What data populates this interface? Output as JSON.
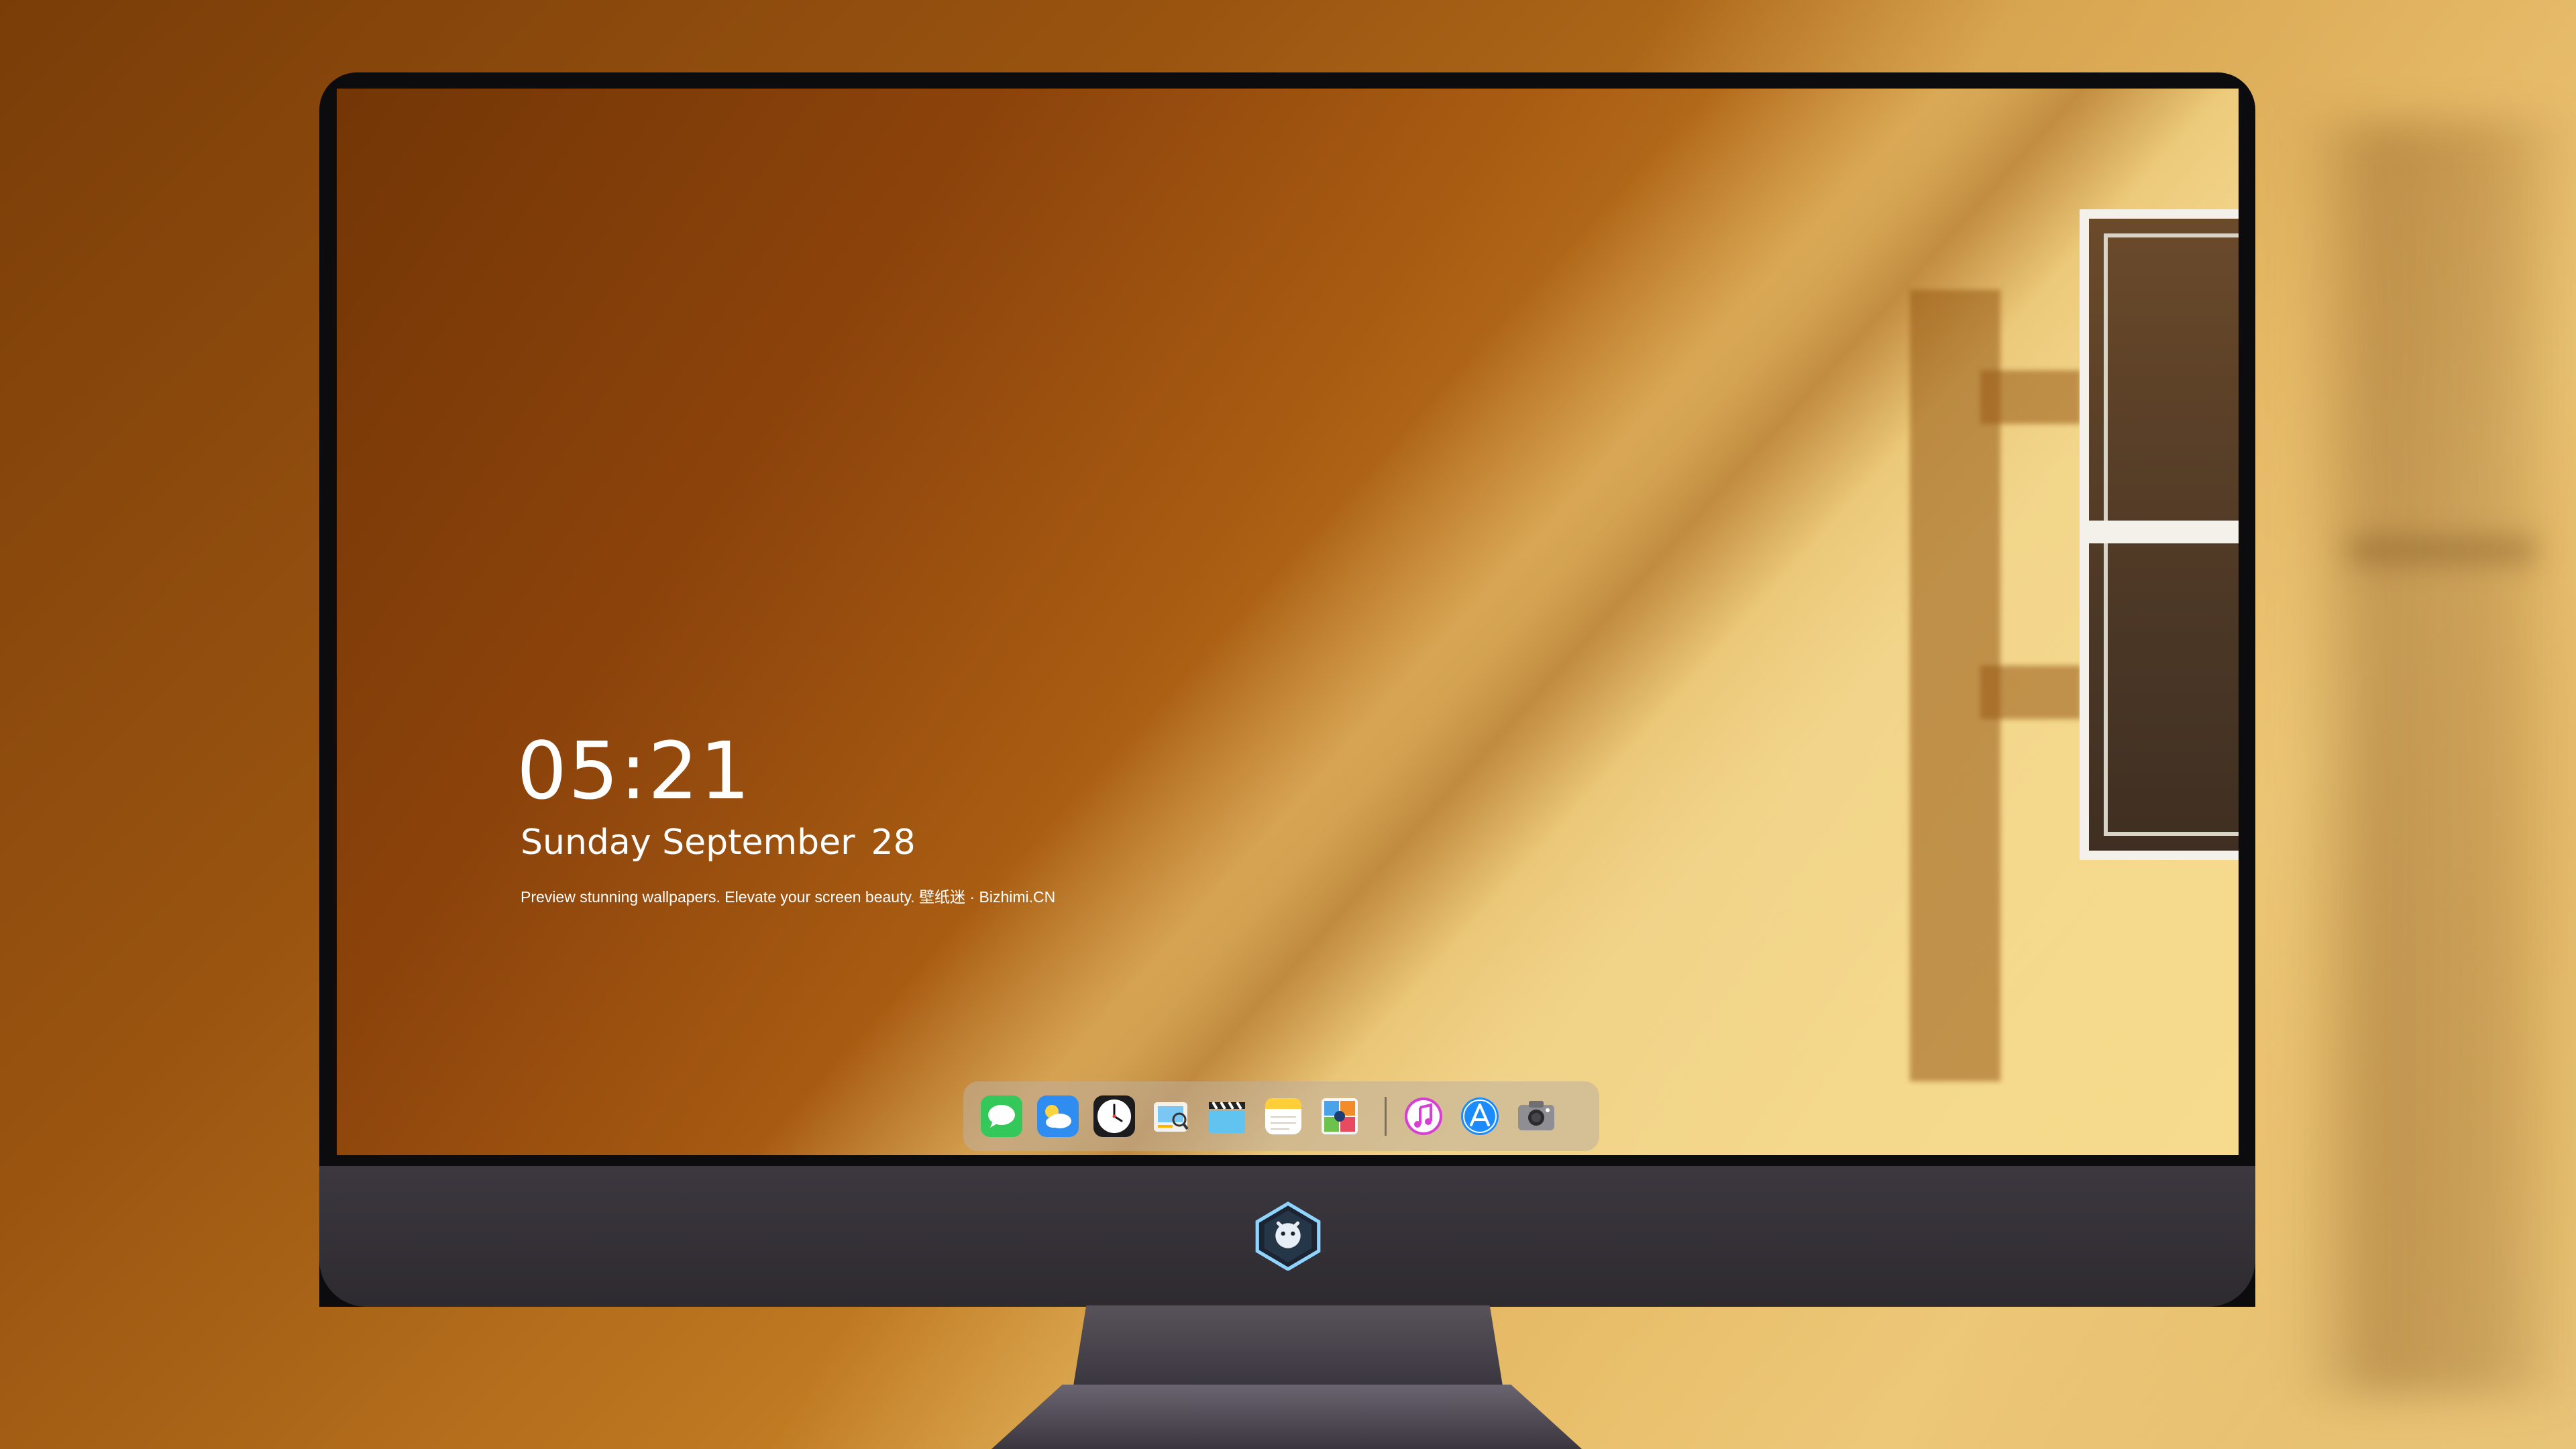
{
  "lockscreen": {
    "time": "05:21",
    "weekday_month": "Sunday September",
    "day": "28",
    "tagline": "Preview stunning wallpapers. Elevate your screen beauty. 壁纸迷 · Bizhimi.CN"
  },
  "dock": {
    "apps": [
      {
        "name": "messages-icon"
      },
      {
        "name": "weather-icon"
      },
      {
        "name": "clock-icon"
      },
      {
        "name": "preview-icon"
      },
      {
        "name": "clips-icon"
      },
      {
        "name": "notes-icon"
      },
      {
        "name": "photo-booth-icon"
      },
      {
        "name": "music-icon"
      },
      {
        "name": "app-store-icon"
      },
      {
        "name": "camera-icon"
      }
    ]
  },
  "colors": {
    "wall_dark": "#8c430b",
    "wall_light": "#e0b261",
    "chin": "#3c383f",
    "dock": "#beafa0"
  }
}
